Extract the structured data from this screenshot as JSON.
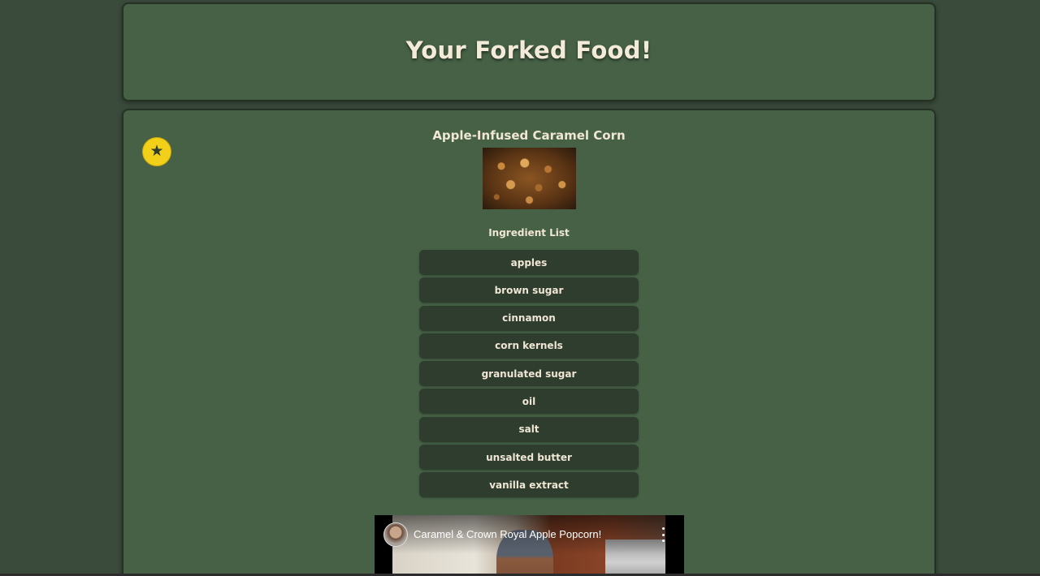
{
  "header": {
    "title": "Your Forked Food!"
  },
  "recipe": {
    "favorite_icon": "star-icon",
    "favorite_color": "#f2cf18",
    "title": "Apple-Infused Caramel Corn",
    "ingredient_heading": "Ingredient List",
    "ingredients": [
      "apples",
      "brown sugar",
      "cinnamon",
      "corn kernels",
      "granulated sugar",
      "oil",
      "salt",
      "unsalted butter",
      "vanilla extract"
    ]
  },
  "video": {
    "title": "Caramel & Crown Royal Apple Popcorn!",
    "menu_icon": "more-vertical-icon"
  },
  "colors": {
    "background": "#3a4a3b",
    "card": "#466146",
    "ingredient_pill": "#2f3d2f",
    "text": "#efe6d4"
  }
}
